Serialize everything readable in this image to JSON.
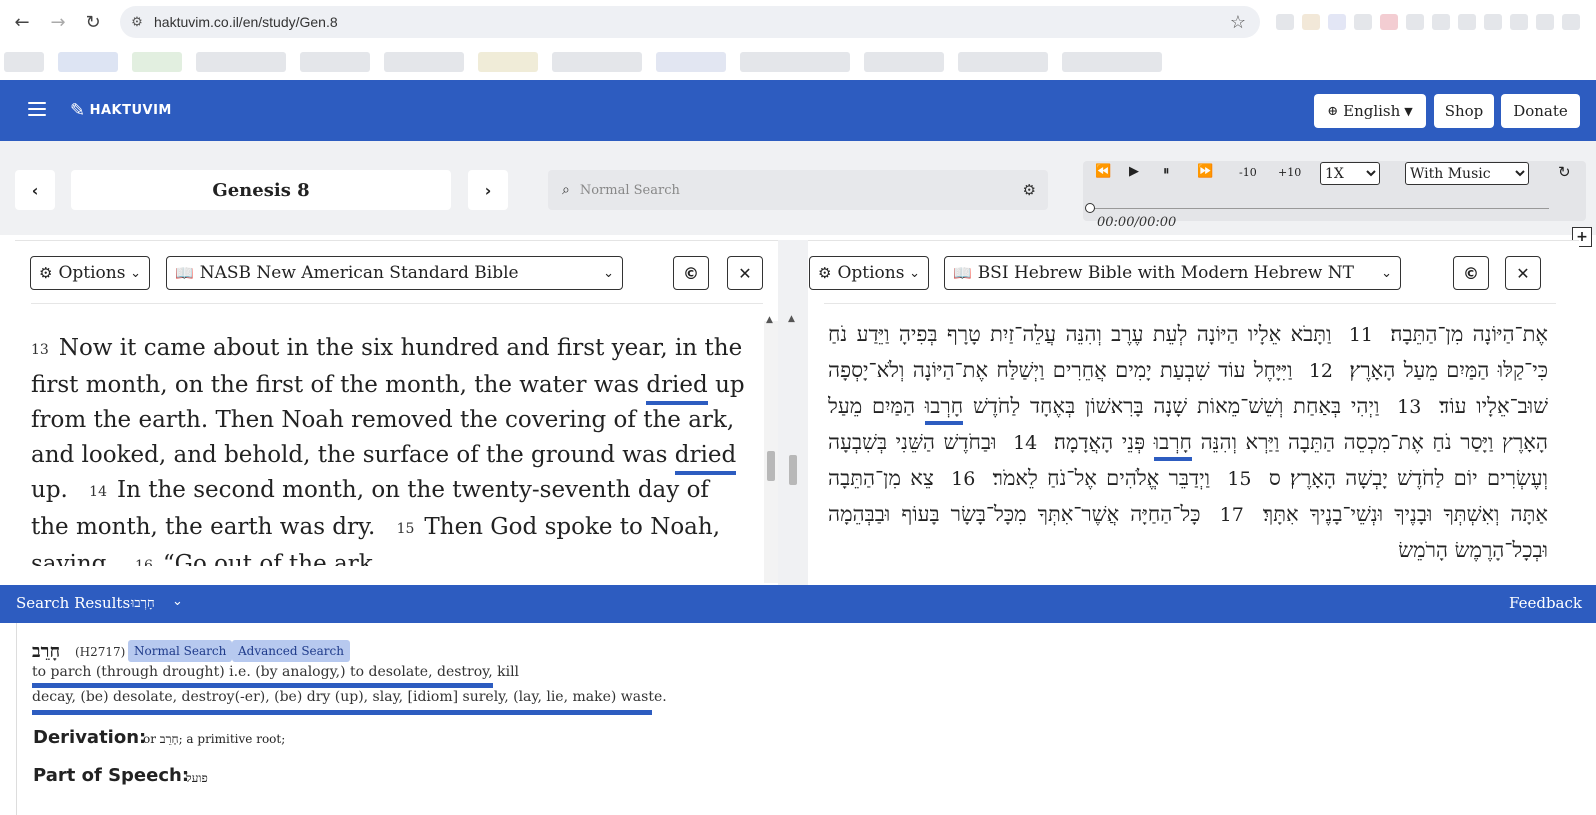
{
  "browser": {
    "url": "haktuvim.co.il/en/study/Gen.8",
    "back_glyph": "←",
    "forward_glyph": "→",
    "reload_glyph": "↻",
    "site_info_glyph": "⚙",
    "star_glyph": "☆"
  },
  "header": {
    "logo_text": "HAKTUVIM",
    "language_label": "English",
    "shop_label": "Shop",
    "donate_label": "Donate",
    "colors": {
      "brand": "#2d5cc0"
    }
  },
  "toolbar": {
    "prev_glyph": "‹",
    "next_glyph": "›",
    "chapter_title": "Genesis 8",
    "search_placeholder": "Normal Search",
    "audio": {
      "back_label": "-10",
      "fwd_label": "+10",
      "speed_selected": "1X",
      "music_selected": "With Music",
      "time": "00:00/00:00",
      "progress": 0
    }
  },
  "panels": {
    "left": {
      "options_label": "Options",
      "version": "NASB New American Standard Bible",
      "verses": [
        {
          "num": "13",
          "parts": [
            "Now it came about in the six hundred and first year, in the first month, on the first of the month, the water was ",
            "dried",
            " up from the earth. Then Noah removed the covering of the ark, and looked, and behold, the surface of the ground was ",
            "dried",
            " up."
          ]
        },
        {
          "num": "14",
          "text": "In the second month, on the twenty-seventh day of the month, the earth was dry."
        },
        {
          "num": "15",
          "text": "Then God spoke to Noah, saying,"
        },
        {
          "num": "16",
          "text": "“Go out of the ark,"
        }
      ]
    },
    "right": {
      "options_label": "Options",
      "version": "BSI Hebrew Bible with Modern Hebrew NT",
      "text_a": "אֶת־הַיּוֹנָה מִן־הַתֵּבָה׃",
      "v11_num": "11",
      "v11": "וַתָּבֹא אֵלָיו הַיּוֹנָה לְעֵת עֶרֶב וְהִנֵּה עֲלֵה־זַיִת טָרָף בְּפִיהָ וַיֵּדַע נֹחַ כִּי־קַלּוּ הַמַּיִם מֵעַל הָאָרֶץ׃",
      "v12_num": "12",
      "v12": "וַיִּיָּחֶל עוֹד שִׁבְעַת יָמִים אֲחֵרִים וַיְשַׁלַּח אֶת־הַיּוֹנָה וְלֹא־יָסְפָה שׁוּב־אֵלָיו עוֹד׃",
      "v13_num": "13",
      "v13a": "וַיְהִי בְּאַחַת וְשֵׁשׁ־מֵאוֹת שָׁנָה בָּרִאשׁוֹן בְּאֶחָד לַחֹדֶשׁ",
      "v13_word1": "חָרְבוּ",
      "v13b": "הַמַּיִם מֵעַל הָאָרֶץ וַיָּסַר נֹחַ אֶת־מִכְסֵה הַתֵּבָה וַיַּרְא וְהִנֵּה",
      "v13_word2": "חָרְבוּ",
      "v13c": "פְּנֵי הָאֲדָמָה׃",
      "v14_num": "14",
      "v14": "וּבַחֹדֶשׁ הַשֵּׁנִי בְּשִׁבְעָה וְעֶשְׂרִים יוֹם לַחֹדֶשׁ יָבְשָׁה הָאָרֶץ׃ ס",
      "v15_num": "15",
      "v15": "וַיְדַבֵּר אֱלֹהִים אֶל־נֹחַ לֵאמֹר׃",
      "v16_num": "16",
      "v16": "צֵא מִן־הַתֵּבָה אַתָּה וְאִשְׁתְּךָ וּבָנֶיךָ וּנְשֵׁי־בָנֶיךָ אִתָּךְ׃",
      "v17_num": "17",
      "v17": "כָּל־הַחַיָּה אֲשֶׁר־אִתְּךָ מִכָּל־בָּשָׂר בָּעוֹף וּבַבְּהֵמָה וּבְכָל־הָרֶמֶשׂ הָרֹמֵשׂ"
    }
  },
  "results": {
    "label": "Search Results",
    "term": "חָרְבוּ",
    "feedback_label": "Feedback",
    "lemma": "חָרֵב",
    "strongs": "(H2717)",
    "normal_search_label": "Normal Search",
    "advanced_search_label": "Advanced Search",
    "definition_1": "to parch (through drought) i.e. (by analogy,) to desolate, destroy, kill",
    "definition_2": "decay, (be) desolate, destroy(-er), (be) dry (up), slay, [idiom] surely, (lay, lie, make) waste.",
    "derivation_label": "Derivation:",
    "derivation_value": "or חָרֵב; a primitive root;",
    "pos_label": "Part of Speech:",
    "pos_value": "פועל"
  }
}
